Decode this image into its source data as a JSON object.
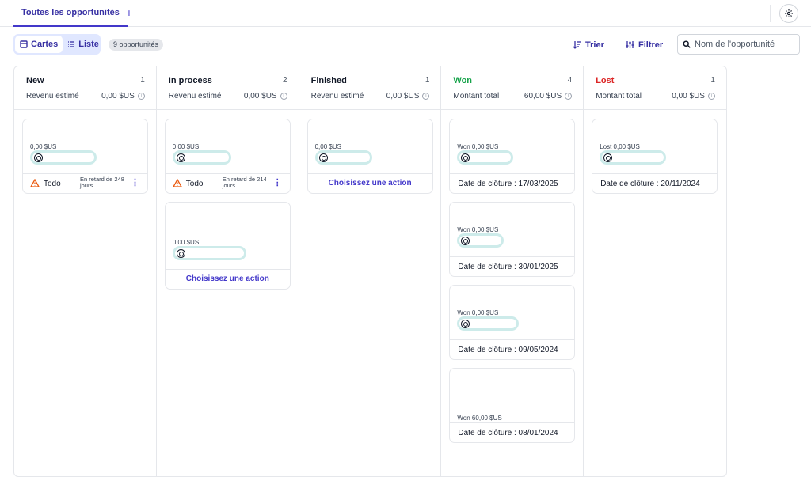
{
  "tabs": {
    "active_label": "Toutes les opportunités",
    "add_label": "+"
  },
  "toolbar": {
    "cards_label": "Cartes",
    "list_label": "Liste",
    "count_badge": "9 opportunités",
    "sort_label": "Trier",
    "filter_label": "Filtrer",
    "search_placeholder": "Nom de l'opportunité"
  },
  "colors": {
    "accent": "#4338ca",
    "won": "#16a34a",
    "lost": "#dc2626",
    "pill": "#cdebea",
    "warning": "#ea580c"
  },
  "columns": [
    {
      "title": "New",
      "count": "1",
      "sub_label": "Revenu estimé",
      "amount": "0,00 $US"
    },
    {
      "title": "In process",
      "count": "2",
      "sub_label": "Revenu estimé",
      "amount": "0,00 $US"
    },
    {
      "title": "Finished",
      "count": "1",
      "sub_label": "Revenu estimé",
      "amount": "0,00 $US"
    },
    {
      "title": "Won",
      "count": "4",
      "sub_label": "Montant total",
      "amount": "60,00 $US"
    },
    {
      "title": "Lost",
      "count": "1",
      "sub_label": "Montant total",
      "amount": "0,00 $US"
    }
  ],
  "cards": {
    "new_0": {
      "amount": "0,00 $US",
      "todo": "Todo",
      "late": "En retard de 248 jours",
      "menu": "⋮"
    },
    "inprocess_0": {
      "amount": "0,00 $US",
      "todo": "Todo",
      "late": "En retard de 214 jours",
      "menu": "⋮"
    },
    "inprocess_1": {
      "amount": "0,00 $US",
      "action": "Choisissez une action"
    },
    "finished_0": {
      "amount": "0,00 $US",
      "action": "Choisissez une action"
    },
    "won_0": {
      "amount": "Won 0,00 $US",
      "date": "Date de clôture : 17/03/2025"
    },
    "won_1": {
      "amount": "Won 0,00 $US",
      "date": "Date de clôture : 30/01/2025"
    },
    "won_2": {
      "amount": "Won 0,00 $US",
      "date": "Date de clôture : 09/05/2024"
    },
    "won_3": {
      "amount": "Won 60,00 $US",
      "date": "Date de clôture : 08/01/2024"
    },
    "lost_0": {
      "amount": "Lost 0,00 $US",
      "date": "Date de clôture : 20/11/2024"
    }
  }
}
